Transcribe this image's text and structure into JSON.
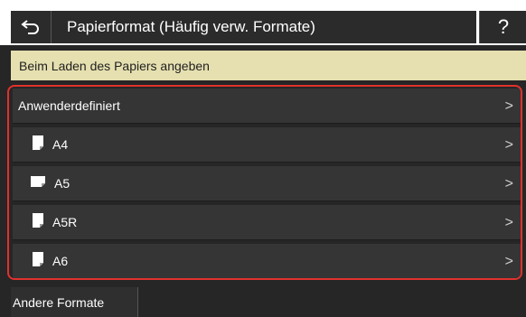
{
  "header": {
    "title": "Papierformat (Häufig verw. Formate)",
    "help_label": "?"
  },
  "banner": {
    "text": "Beim Laden des Papiers angeben"
  },
  "list": {
    "items": [
      {
        "label": "Anwenderdefiniert",
        "icon": "none"
      },
      {
        "label": "A4",
        "icon": "paper-portrait-icon"
      },
      {
        "label": "A5",
        "icon": "paper-landscape-icon"
      },
      {
        "label": "A5R",
        "icon": "paper-portrait-icon"
      },
      {
        "label": "A6",
        "icon": "paper-portrait-icon"
      }
    ],
    "chevron": ">"
  },
  "footer": {
    "other_formats_label": "Andere Formate"
  },
  "colors": {
    "background": "#262626",
    "banner": "#e6e0b0",
    "highlight_border": "#e0312d"
  }
}
